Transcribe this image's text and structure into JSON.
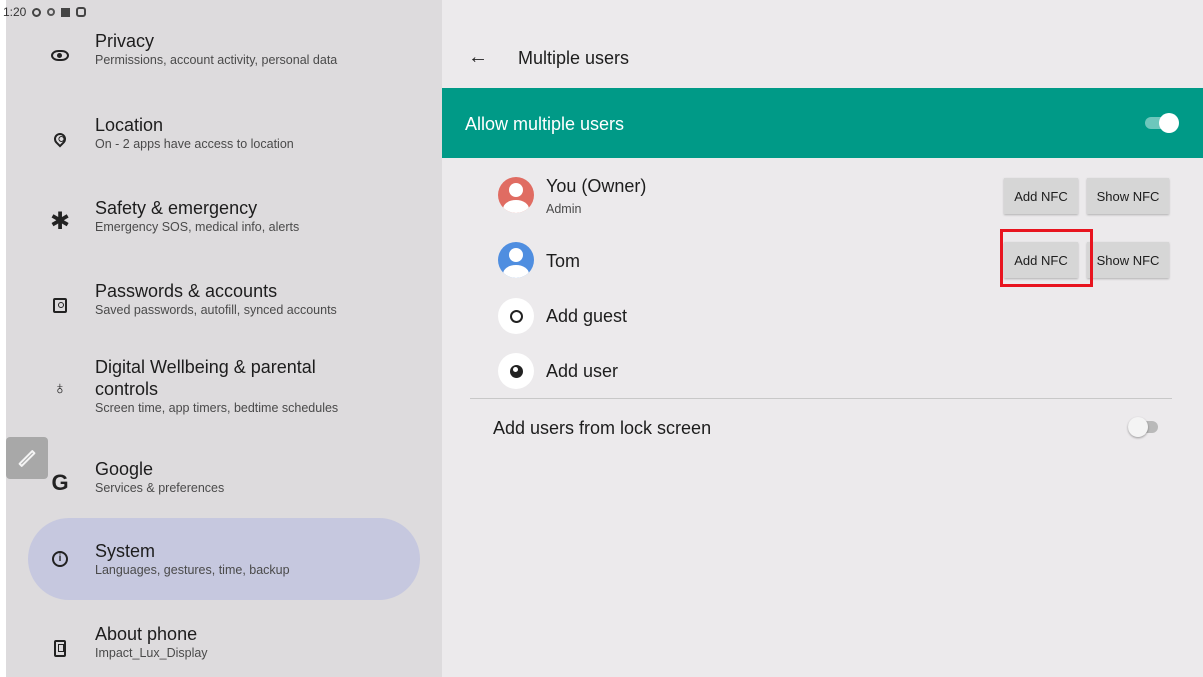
{
  "status_bar": {
    "time": "1:20",
    "icons": [
      "settings-icon",
      "dot-icon",
      "square-icon",
      "android-icon",
      "wifi-icon"
    ]
  },
  "settings_list": {
    "items": [
      {
        "title": "Privacy",
        "subtitle": "Permissions, account activity, personal data",
        "icon": "privacy-eye-icon"
      },
      {
        "title": "Location",
        "subtitle": "On - 2 apps have access to location",
        "icon": "location-pin-icon"
      },
      {
        "title": "Safety & emergency",
        "subtitle": "Emergency SOS, medical info, alerts",
        "icon": "asterisk-icon"
      },
      {
        "title": "Passwords & accounts",
        "subtitle": "Saved passwords, autofill, synced accounts",
        "icon": "account-box-icon"
      },
      {
        "title": "Digital Wellbeing & parental",
        "title2": "controls",
        "subtitle": "Screen time, app timers, bedtime schedules",
        "icon": "wellbeing-icon"
      },
      {
        "title": "Google",
        "subtitle": "Services & preferences",
        "icon": "google-g-icon"
      },
      {
        "title": "System",
        "subtitle": "Languages, gestures, time, backup",
        "icon": "info-icon",
        "active": true
      },
      {
        "title": "About phone",
        "subtitle": "Impact_Lux_Display",
        "icon": "phone-icon"
      }
    ]
  },
  "edit_button": {
    "icon": "pencil-icon"
  },
  "header": {
    "back_icon": "←",
    "title": "Multiple users"
  },
  "allow_banner": {
    "label": "Allow multiple users",
    "toggle_on": true,
    "color": "#009a87"
  },
  "users": [
    {
      "name": "You (Owner)",
      "subtitle": "Admin",
      "avatar_color": "#e06c62",
      "add_nfc": "Add NFC",
      "show_nfc": "Show NFC"
    },
    {
      "name": "Tom",
      "subtitle": "",
      "avatar_color": "#4f8ee0",
      "add_nfc": "Add NFC",
      "show_nfc": "Show NFC"
    }
  ],
  "add_guest": {
    "label": "Add guest",
    "icon": "guest-face-icon"
  },
  "add_user": {
    "label": "Add user",
    "icon": "add-user-icon"
  },
  "lock_screen": {
    "label": "Add users from lock screen",
    "toggle_on": false
  },
  "highlight_color": "#e8141f"
}
